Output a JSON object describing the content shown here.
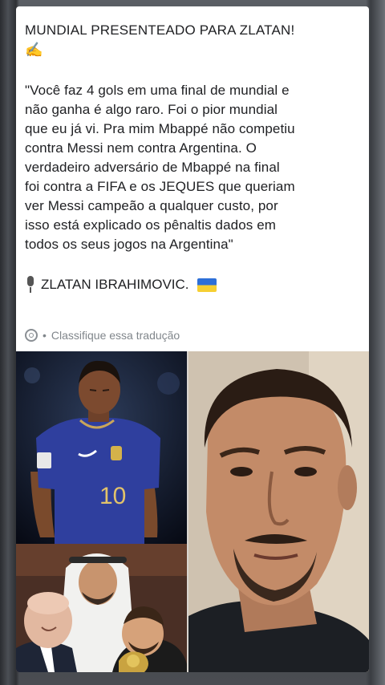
{
  "post": {
    "headline": "MUNDIAL PRESENTEADO PARA ZLATAN!",
    "headline_emoji": "✍",
    "quote_lines": [
      "\"Você faz 4 gols em uma final de mundial e",
      "não ganha é algo raro. Foi o pior mundial",
      "que eu já vi. Pra mim Mbappé não competiu",
      "contra Messi nem contra Argentina. O",
      "verdadeiro adversário de Mbappé na final",
      "foi contra a FIFA e os JEQUES que queriam",
      "ver Messi campeão a qualquer custo, por",
      "isso está explicado os pênaltis dados em",
      "todos os seus jogos na Argentina\""
    ],
    "author": "ZLATAN IBRAHIMOVIC.",
    "author_icon": "microphone-icon",
    "author_flag": "ukraine-flag"
  },
  "translation": {
    "icon": "gear-icon",
    "separator": "•",
    "label": "Classifique essa tradução"
  },
  "photos": {
    "top_left": {
      "jersey_number": "10"
    }
  },
  "colors": {
    "text": "#202124",
    "meta_text": "#80868b",
    "card_bg": "#ffffff",
    "jersey_blue": "#2f3f9e"
  }
}
